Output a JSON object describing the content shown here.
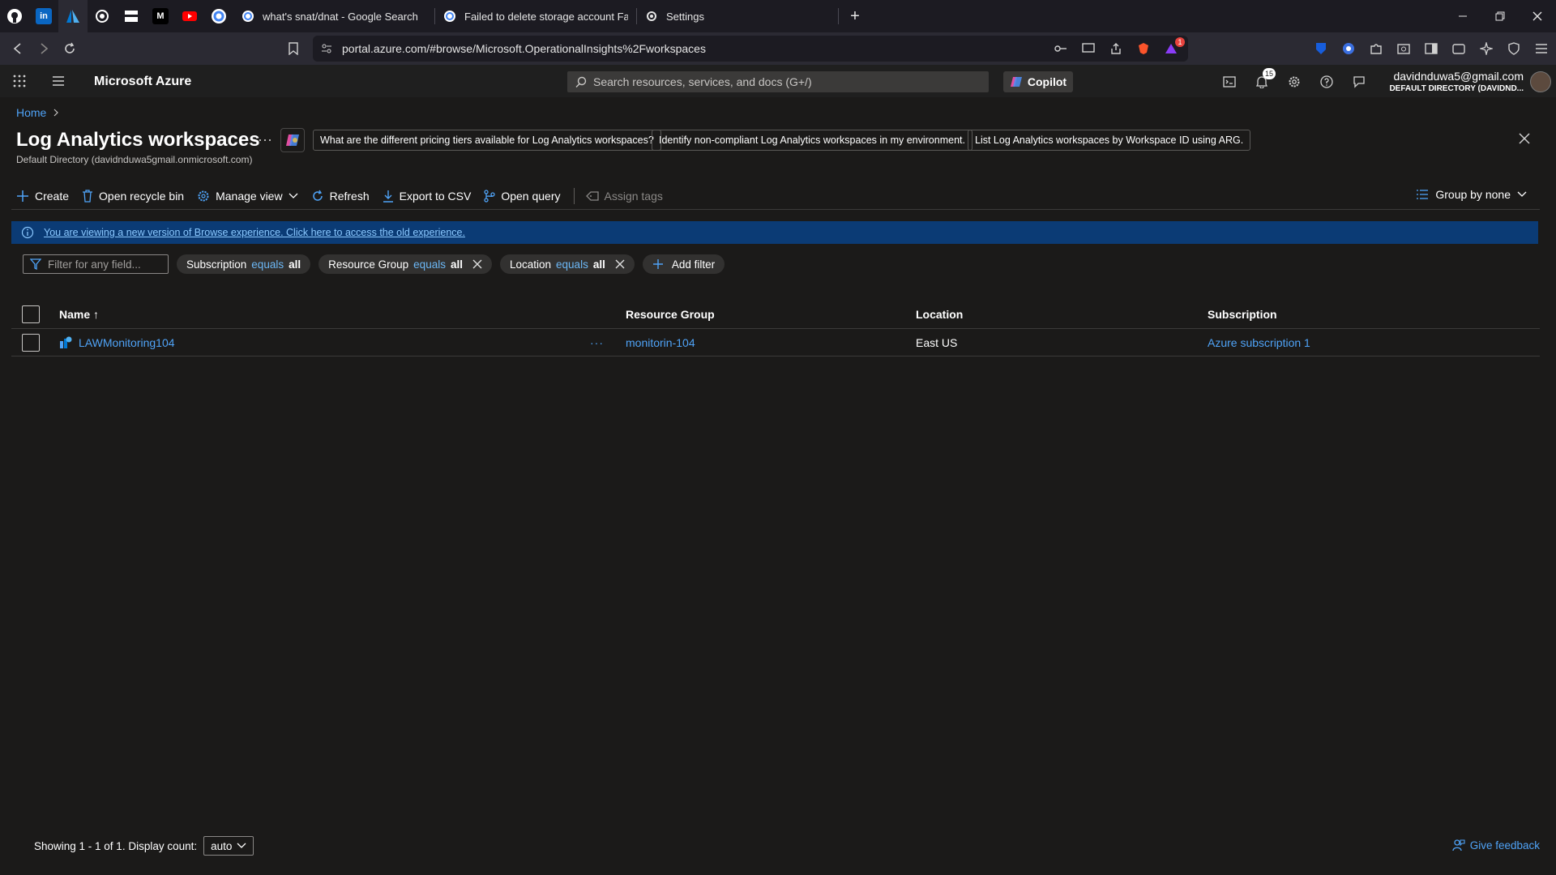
{
  "browser": {
    "tabs": [
      {
        "title": "what's snat/dnat - Google Search"
      },
      {
        "title": "Failed to delete storage account Faile"
      },
      {
        "title": "Settings"
      }
    ],
    "url": "portal.azure.com/#browse/Microsoft.OperationalInsights%2Fworkspaces",
    "extension_badge": "1"
  },
  "azure": {
    "brand": "Microsoft Azure",
    "search_placeholder": "Search resources, services, and docs (G+/)",
    "copilot_label": "Copilot",
    "notifications_count": "15",
    "account_email": "davidnduwa5@gmail.com",
    "account_directory": "DEFAULT DIRECTORY (DAVIDND..."
  },
  "breadcrumb": {
    "home": "Home"
  },
  "page": {
    "title": "Log Analytics workspaces",
    "subtitle": "Default Directory (davidnduwa5gmail.onmicrosoft.com)",
    "suggestions": [
      "What are the different pricing tiers available for Log Analytics workspaces?",
      "Identify non-compliant Log Analytics workspaces in my environment.",
      "List Log Analytics workspaces by Workspace ID using ARG."
    ]
  },
  "toolbar": {
    "create": "Create",
    "recycle": "Open recycle bin",
    "manage_view": "Manage view",
    "refresh": "Refresh",
    "export": "Export to CSV",
    "open_query": "Open query",
    "assign_tags": "Assign tags",
    "group_by": "Group by none"
  },
  "banner": {
    "text": "You are viewing a new version of Browse experience. Click here to access the old experience."
  },
  "filters": {
    "placeholder": "Filter for any field...",
    "pills": [
      {
        "field": "Subscription",
        "op": "equals",
        "value": "all"
      },
      {
        "field": "Resource Group",
        "op": "equals",
        "value": "all"
      },
      {
        "field": "Location",
        "op": "equals",
        "value": "all"
      }
    ],
    "add_filter": "Add filter"
  },
  "table": {
    "headers": {
      "name": "Name ↑",
      "resource_group": "Resource Group",
      "location": "Location",
      "subscription": "Subscription"
    },
    "rows": [
      {
        "name": "LAWMonitoring104",
        "resource_group": "monitorin-104",
        "location": "East US",
        "subscription": "Azure subscription 1"
      }
    ]
  },
  "footer": {
    "showing": "Showing 1 - 1 of 1. Display count:",
    "display_count": "auto",
    "feedback": "Give feedback"
  }
}
